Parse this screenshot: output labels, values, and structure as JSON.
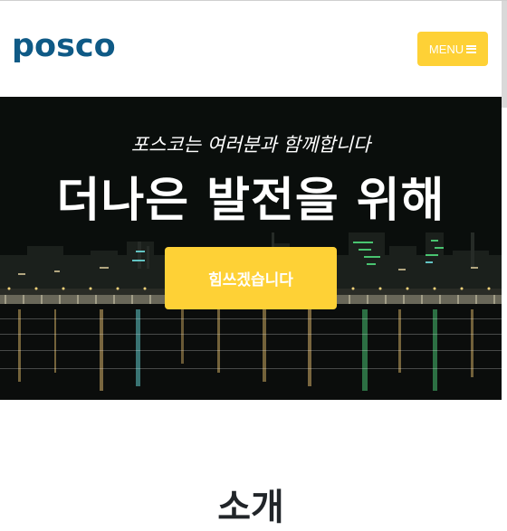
{
  "navbar": {
    "logo_text": "posco",
    "menu_label": "MENU",
    "menu_icon": "hamburger-icon"
  },
  "hero": {
    "subtitle": "포스코는 여러분과 함께합니다",
    "title": "더나은 발전을 위해",
    "cta_label": "힘쓰겠습니다",
    "background_image": "night-industrial-waterfront"
  },
  "about": {
    "heading": "소개"
  },
  "colors": {
    "brand_blue": "#0f5a86",
    "accent_yellow": "#fed136",
    "heading_dark": "#212529"
  }
}
